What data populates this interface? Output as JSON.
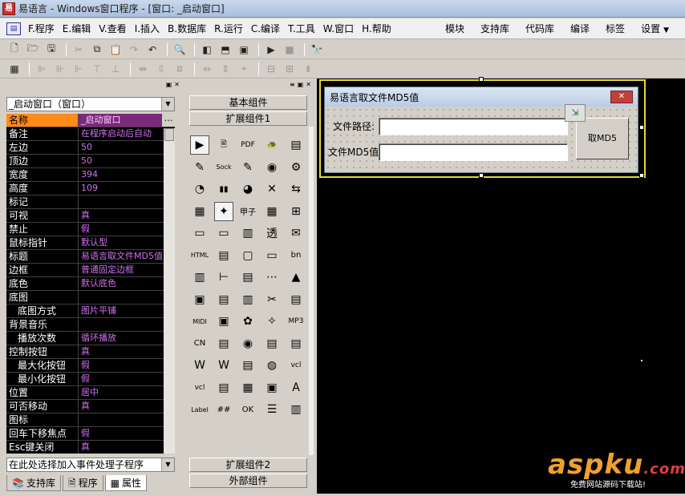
{
  "window": {
    "title": "易语言 - Windows窗口程序 - [窗口: _启动窗口]"
  },
  "menu": {
    "left": [
      "F.程序",
      "E.编辑",
      "V.查看",
      "I.插入",
      "B.数据库",
      "R.运行",
      "C.编译",
      "T.工具",
      "W.窗口",
      "H.帮助"
    ],
    "right": [
      "模块",
      "支持库",
      "代码库",
      "编译",
      "标签",
      "设置"
    ]
  },
  "left_panel": {
    "object_combo": "_启动窗口（窗口）",
    "properties": [
      {
        "name": "名称",
        "value": "_启动窗口",
        "selected": true
      },
      {
        "name": "备注",
        "value": "在程序启动后自动"
      },
      {
        "name": "左边",
        "value": "50"
      },
      {
        "name": "顶边",
        "value": "50"
      },
      {
        "name": "宽度",
        "value": "394"
      },
      {
        "name": "高度",
        "value": "109"
      },
      {
        "name": "标记",
        "value": ""
      },
      {
        "name": "可视",
        "value": "真"
      },
      {
        "name": "禁止",
        "value": "假"
      },
      {
        "name": "鼠标指针",
        "value": "默认型"
      },
      {
        "name": "标题",
        "value": "易语言取文件MD5值"
      },
      {
        "name": "边框",
        "value": "普通固定边框"
      },
      {
        "name": "底色",
        "value": "默认底色"
      },
      {
        "name": "底图",
        "value": ""
      },
      {
        "name": "底图方式",
        "value": "图片平铺",
        "indent": true
      },
      {
        "name": "背景音乐",
        "value": ""
      },
      {
        "name": "播放次数",
        "value": "循环播放",
        "indent": true
      },
      {
        "name": "控制按钮",
        "value": "真"
      },
      {
        "name": "最大化按钮",
        "value": "假",
        "indent": true
      },
      {
        "name": "最小化按钮",
        "value": "假",
        "indent": true
      },
      {
        "name": "位置",
        "value": "居中"
      },
      {
        "name": "可否移动",
        "value": "真"
      },
      {
        "name": "图标",
        "value": ""
      },
      {
        "name": "回车下移焦点",
        "value": "假"
      },
      {
        "name": "Esc键关闭",
        "value": "真"
      }
    ],
    "event_combo": "在此处选择加入事件处理子程序",
    "tabs": [
      "支持库",
      "程序",
      "属性"
    ]
  },
  "middle_panel": {
    "basic_group": "基本组件",
    "ext_group1": "扩展组件1",
    "ext_group2": "扩展组件2",
    "external_group": "外部组件",
    "icons": [
      "▶",
      "🖹",
      "PDF",
      "🐢",
      "▤",
      "✎",
      "Sock",
      "✎",
      "◉",
      "⚙",
      "◔",
      "▮▮",
      "◕",
      "✕",
      "⇆",
      "▦",
      "✦",
      "甲子",
      "▦",
      "⊞",
      "▭",
      "▭",
      "▥",
      "透",
      "✉",
      "HTML",
      "▤",
      "▢",
      "▭",
      "bn",
      "▥",
      "⊢",
      "▤",
      "⋯",
      "▲",
      "▣",
      "▤",
      "▥",
      "✂",
      "▤",
      "MIDI",
      "▣",
      "✿",
      "✧",
      "MP3",
      "CN",
      "▤",
      "◉",
      "▤",
      "▤",
      "W",
      "W",
      "▤",
      "◍",
      "vcl",
      "vcl",
      "▤",
      "▦",
      "▣",
      "A",
      "Label",
      "##",
      "OK",
      "☰",
      "▥"
    ]
  },
  "form": {
    "title": "易语言取文件MD5值",
    "path_label": "文件路径:",
    "md5_label": "文件MD5值:",
    "button": "取MD5"
  },
  "watermark": {
    "main": "aspku",
    "tld": ".com",
    "sub": "免费网站源码下载站!"
  }
}
